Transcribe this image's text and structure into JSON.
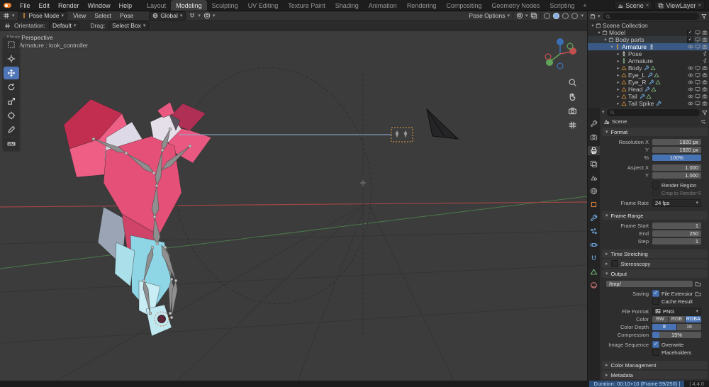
{
  "icons": {
    "caret": "▾",
    "caret_closed": "▸",
    "close": "×",
    "check": "✓",
    "plus": "+"
  },
  "topbar": {
    "menus": [
      "File",
      "Edit",
      "Render",
      "Window",
      "Help"
    ],
    "workspaces": [
      "Layout",
      "Modeling",
      "Sculpting",
      "UV Editing",
      "Texture Paint",
      "Shading",
      "Animation",
      "Rendering",
      "Compositing",
      "Geometry Nodes",
      "Scripting"
    ],
    "scene_name": "Scene",
    "view_layer_name": "ViewLayer"
  },
  "viewport_header": {
    "mode": "Pose Mode",
    "menu_view": "View",
    "menu_select": "Select",
    "menu_pose": "Pose",
    "orientation": "Global",
    "pose_options": "Pose Options"
  },
  "tool_settings": {
    "orientation_label": "Orientation:",
    "orientation_value": "Default",
    "drag_label": "Drag:",
    "drag_value": "Select Box"
  },
  "viewport": {
    "overlay_view": "User Perspective",
    "overlay_object": "(59) Armature : look_controller"
  },
  "outliner": {
    "rows": [
      {
        "label": "Scene Collection"
      },
      {
        "label": "Model"
      },
      {
        "label": "Body parts"
      },
      {
        "label": "Armature"
      },
      {
        "label": "Pose"
      },
      {
        "label": "Armature"
      },
      {
        "label": "Body"
      },
      {
        "label": "Eye_L"
      },
      {
        "label": "Eye_R"
      },
      {
        "label": "Head"
      },
      {
        "label": "Tail"
      },
      {
        "label": "Tail Spike"
      }
    ]
  },
  "properties": {
    "breadcrumb": "Scene",
    "format": {
      "title": "Format",
      "resolution_x_label": "Resolution X",
      "resolution_x": "1920 px",
      "resolution_y_label": "Y",
      "resolution_y": "1920 px",
      "resolution_pct_label": "%",
      "resolution_pct": "100%",
      "aspect_x_label": "Aspect X",
      "aspect_x": "1.000",
      "aspect_y_label": "Y",
      "aspect_y": "1.000",
      "render_region": "Render Region",
      "crop_to_render_region": "Crop to Render Region",
      "frame_rate_label": "Frame Rate",
      "frame_rate": "24 fps"
    },
    "frame_range": {
      "title": "Frame Range",
      "start_label": "Frame Start",
      "start": "1",
      "end_label": "End",
      "end": "250",
      "step_label": "Step",
      "step": "1"
    },
    "time_stretching": "Time Stretching",
    "stereoscopy": "Stereoscopy",
    "output": {
      "title": "Output",
      "path": "/tmp/",
      "saving_label": "Saving",
      "file_extensions": "File Extensions",
      "cache_result": "Cache Result",
      "file_format_label": "File Format",
      "file_format": "PNG",
      "color_label": "Color",
      "color_options": [
        "BW",
        "RGB",
        "RGBA"
      ],
      "color_depth_label": "Color Depth",
      "color_depth_options": [
        "8",
        "16"
      ],
      "compression_label": "Compression",
      "compression": "15%",
      "image_sequence_label": "Image Sequence",
      "overwrite": "Overwrite",
      "placeholders": "Placeholders"
    },
    "color_management": "Color Management",
    "metadata": "Metadata"
  },
  "statusbar": {
    "duration": "Duration: 00:10+10 (Frame 59/250) |",
    "version": "| 4.4.0"
  },
  "colors": {
    "accent_blue": "#4772b3",
    "selection_row": "#3a5a85",
    "viewport_bg": "#3c3c3c",
    "model_pink": "#e45077",
    "model_cyan": "#8ed6e6"
  }
}
